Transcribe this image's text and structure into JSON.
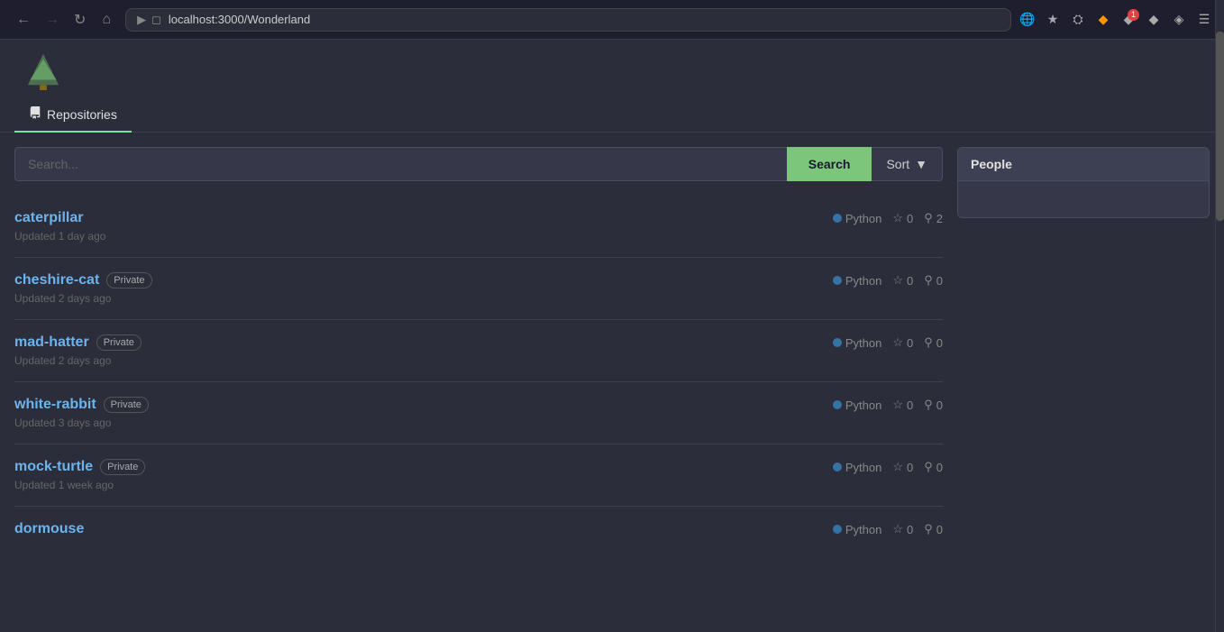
{
  "browser": {
    "url": "localhost:3000/Wonderland",
    "back_disabled": false,
    "forward_disabled": false,
    "badge_count": "1"
  },
  "tabs": [
    {
      "id": "repositories",
      "label": "Repositories",
      "active": true,
      "icon": "repo"
    }
  ],
  "search": {
    "placeholder": "Search...",
    "button_label": "Search",
    "sort_label": "Sort"
  },
  "people_section": {
    "header": "People"
  },
  "repositories": [
    {
      "name": "caterpillar",
      "private": false,
      "language": "Python",
      "stars": "0",
      "forks": "2",
      "updated": "Updated 1 day ago"
    },
    {
      "name": "cheshire-cat",
      "private": true,
      "language": "Python",
      "stars": "0",
      "forks": "0",
      "updated": "Updated 2 days ago"
    },
    {
      "name": "mad-hatter",
      "private": true,
      "language": "Python",
      "stars": "0",
      "forks": "0",
      "updated": "Updated 2 days ago"
    },
    {
      "name": "white-rabbit",
      "private": true,
      "language": "Python",
      "stars": "0",
      "forks": "0",
      "updated": "Updated 3 days ago"
    },
    {
      "name": "mock-turtle",
      "private": true,
      "language": "Python",
      "stars": "0",
      "forks": "0",
      "updated": "Updated 1 week ago"
    },
    {
      "name": "dormouse",
      "private": false,
      "language": "Python",
      "stars": "0",
      "forks": "0",
      "updated": ""
    }
  ],
  "labels": {
    "private": "Private",
    "updated_prefix": "Updated"
  },
  "colors": {
    "python_lang": "#3572A5",
    "repo_name": "#6cb4ee",
    "active_tab": "#6ee7a0"
  }
}
